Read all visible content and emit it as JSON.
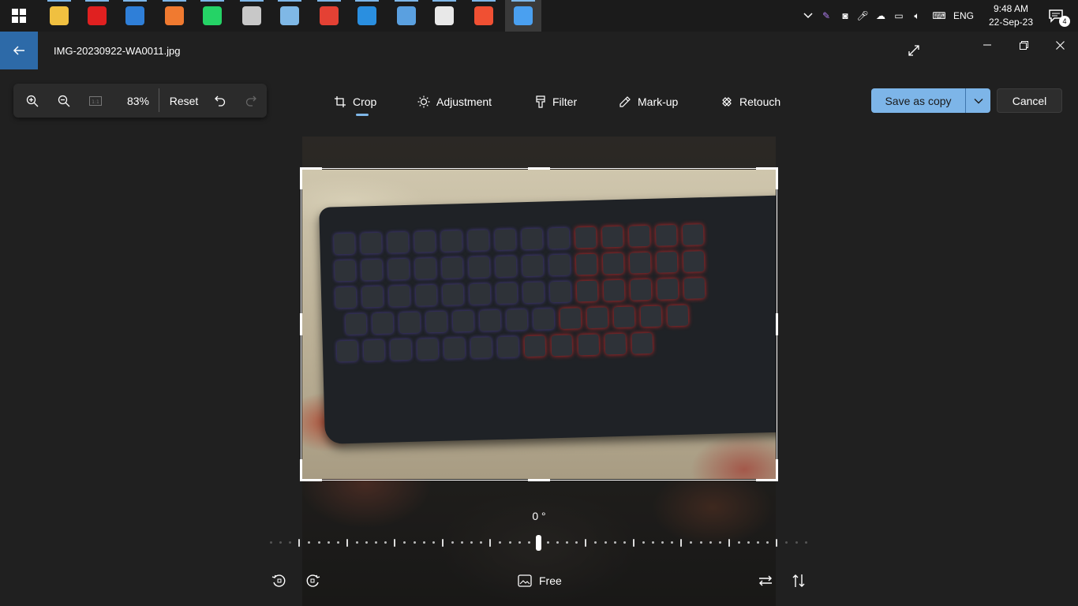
{
  "taskbar": {
    "apps": [
      {
        "name": "file-explorer-icon",
        "color": "#f0c040"
      },
      {
        "name": "screen-recorder-icon",
        "color": "#e02020"
      },
      {
        "name": "microsoft-store-icon",
        "color": "#2f7fd8"
      },
      {
        "name": "xampp-icon",
        "color": "#f07a30"
      },
      {
        "name": "whatsapp-icon",
        "color": "#25d366"
      },
      {
        "name": "presentation-app-icon",
        "color": "#c8c8c8"
      },
      {
        "name": "notepad-icon",
        "color": "#7fb8e6"
      },
      {
        "name": "chrome-icon",
        "color": "#e44134"
      },
      {
        "name": "vscode-icon",
        "color": "#2a8fe0"
      },
      {
        "name": "remote-desktop-icon",
        "color": "#5aa0e0"
      },
      {
        "name": "paint-icon",
        "color": "#e8e8e8"
      },
      {
        "name": "git-icon",
        "color": "#f05033"
      },
      {
        "name": "photos-icon",
        "color": "#4aa0f0"
      }
    ],
    "tray": {
      "language": "ENG",
      "time": "9:48 AM",
      "date": "22-Sep-23",
      "notifications": "4"
    }
  },
  "titlebar": {
    "file_name": "IMG-20230922-WA0011.jpg"
  },
  "zoom": {
    "percent": "83%",
    "reset_label": "Reset"
  },
  "tools": {
    "crop": "Crop",
    "adjustment": "Adjustment",
    "filter": "Filter",
    "markup": "Mark-up",
    "retouch": "Retouch"
  },
  "actions": {
    "save_as_copy": "Save as copy",
    "cancel": "Cancel"
  },
  "rotation": {
    "angle": "0 °",
    "aspect_label": "Free"
  },
  "colors": {
    "accent": "#7db5e8",
    "background": "#202020"
  }
}
